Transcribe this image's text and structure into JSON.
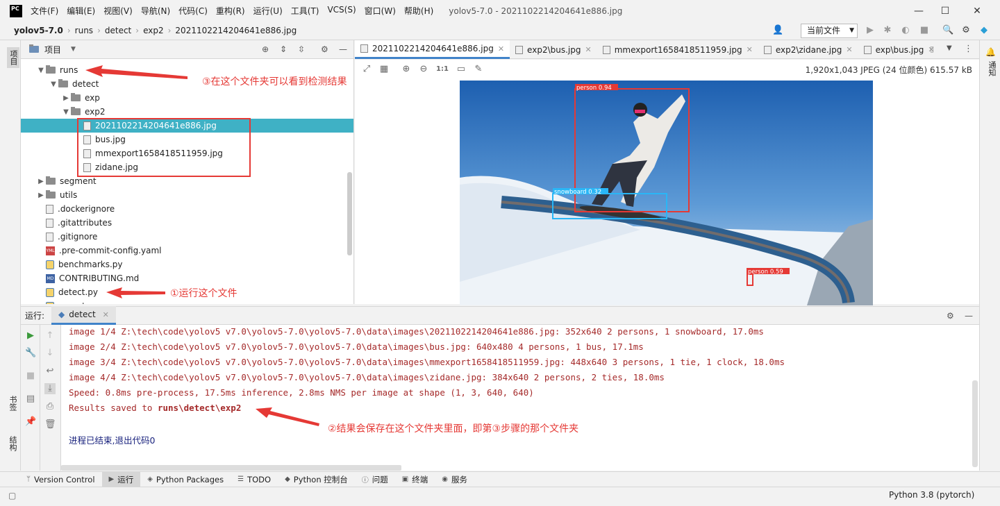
{
  "app": {
    "logo": "PC",
    "window_title": "yolov5-7.0 - 2021102214204641e886.jpg",
    "menus": [
      "文件(F)",
      "编辑(E)",
      "视图(V)",
      "导航(N)",
      "代码(C)",
      "重构(R)",
      "运行(U)",
      "工具(T)",
      "VCS(S)",
      "窗口(W)",
      "帮助(H)"
    ],
    "window_controls": {
      "minimize": "—",
      "maximize": "☐",
      "close": "✕"
    }
  },
  "breadcrumb": [
    "yolov5-7.0",
    "runs",
    "detect",
    "exp2",
    "2021102214204641e886.jpg"
  ],
  "toolbar": {
    "run_config": "当前文件"
  },
  "left_strip": {
    "project_label": "项目",
    "bookmarks_label": "书签",
    "structure_label": "结构"
  },
  "right_strip": {
    "notifications_label": "通知"
  },
  "project_panel": {
    "title": "项目",
    "tree": [
      {
        "label": "runs",
        "kind": "folder",
        "arrow": "▼",
        "depth": 1
      },
      {
        "label": "detect",
        "kind": "folder",
        "arrow": "▼",
        "depth": 2
      },
      {
        "label": "exp",
        "kind": "folder",
        "arrow": "▶",
        "depth": 3
      },
      {
        "label": "exp2",
        "kind": "folder",
        "arrow": "▼",
        "depth": 3
      },
      {
        "label": "2021102214204641e886.jpg",
        "kind": "file",
        "arrow": "",
        "depth": 4,
        "selected": true
      },
      {
        "label": "bus.jpg",
        "kind": "file",
        "arrow": "",
        "depth": 4
      },
      {
        "label": "mmexport1658418511959.jpg",
        "kind": "file",
        "arrow": "",
        "depth": 4
      },
      {
        "label": "zidane.jpg",
        "kind": "file",
        "arrow": "",
        "depth": 4
      },
      {
        "label": "segment",
        "kind": "folder",
        "arrow": "▶",
        "depth": 1
      },
      {
        "label": "utils",
        "kind": "folder",
        "arrow": "▶",
        "depth": 1
      },
      {
        "label": ".dockerignore",
        "kind": "file",
        "arrow": "",
        "depth": 1
      },
      {
        "label": ".gitattributes",
        "kind": "file",
        "arrow": "",
        "depth": 1
      },
      {
        "label": ".gitignore",
        "kind": "file",
        "arrow": "",
        "depth": 1
      },
      {
        "label": ".pre-commit-config.yaml",
        "kind": "yml",
        "arrow": "",
        "depth": 1
      },
      {
        "label": "benchmarks.py",
        "kind": "py",
        "arrow": "",
        "depth": 1
      },
      {
        "label": "CONTRIBUTING.md",
        "kind": "md",
        "arrow": "",
        "depth": 1
      },
      {
        "label": "detect.py",
        "kind": "py",
        "arrow": "",
        "depth": 1
      },
      {
        "label": "export.py",
        "kind": "py",
        "arrow": "",
        "depth": 1
      }
    ]
  },
  "editor_tabs": [
    {
      "label": "2021102214204641e886.jpg",
      "active": true
    },
    {
      "label": "exp2\\bus.jpg",
      "active": false
    },
    {
      "label": "mmexport1658418511959.jpg",
      "active": false
    },
    {
      "label": "exp2\\zidane.jpg",
      "active": false
    },
    {
      "label": "exp\\bus.jpg",
      "active": false
    }
  ],
  "image_viewer": {
    "info": "1,920x1,043 JPEG (24 位颜色) 615.57 kB",
    "zoom_actual": "1:1",
    "detections": [
      {
        "label": "person 0.94",
        "color": "#e53935"
      },
      {
        "label": "snowboard 0.32",
        "color": "#29b6f6"
      },
      {
        "label": "person 0.59",
        "color": "#e53935"
      }
    ]
  },
  "run_panel": {
    "label": "运行:",
    "tab": "detect",
    "lines": [
      "image 1/4 Z:\\tech\\code\\yolov5 v7.0\\yolov5-7.0\\yolov5-7.0\\data\\images\\2021102214204641e886.jpg: 352x640 2 persons, 1 snowboard, 17.0ms",
      "image 2/4 Z:\\tech\\code\\yolov5 v7.0\\yolov5-7.0\\yolov5-7.0\\data\\images\\bus.jpg: 640x480 4 persons, 1 bus, 17.1ms",
      "image 3/4 Z:\\tech\\code\\yolov5 v7.0\\yolov5-7.0\\yolov5-7.0\\data\\images\\mmexport1658418511959.jpg: 448x640 3 persons, 1 tie, 1 clock, 18.0ms",
      "image 4/4 Z:\\tech\\code\\yolov5 v7.0\\yolov5-7.0\\yolov5-7.0\\data\\images\\zidane.jpg: 384x640 2 persons, 2 ties, 18.0ms",
      "Speed: 0.8ms pre-process, 17.5ms inference, 2.8ms NMS per image at shape (1, 3, 640, 640)"
    ],
    "results_prefix": "Results saved to ",
    "results_path": "runs\\detect\\exp2",
    "exit_message": "进程已结束,退出代码0"
  },
  "tool_windows": [
    {
      "icon": "ᛘ",
      "label": "Version Control"
    },
    {
      "icon": "▶",
      "label": "运行",
      "active": true
    },
    {
      "icon": "◈",
      "label": "Python Packages"
    },
    {
      "icon": "☰",
      "label": "TODO"
    },
    {
      "icon": "◆",
      "label": "Python 控制台"
    },
    {
      "icon": "ⓘ",
      "label": "问题"
    },
    {
      "icon": "▣",
      "label": "终端"
    },
    {
      "icon": "◉",
      "label": "服务"
    }
  ],
  "status_bar": {
    "interpreter": "Python 3.8 (pytorch)"
  },
  "annotations": {
    "step1": "①运行这个文件",
    "step2": "②结果会保存在这个文件夹里面，即第③步骤的那个文件夹",
    "step3": "③在这个文件夹可以看到检测结果",
    "color": "#e53935"
  }
}
